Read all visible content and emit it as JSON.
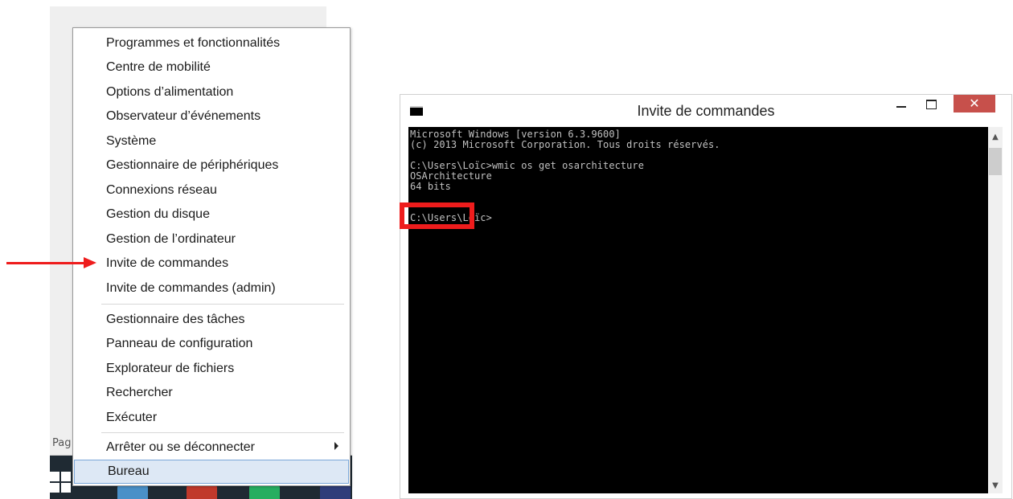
{
  "desktop": {
    "page_label": "Pag"
  },
  "context_menu": {
    "items": [
      {
        "label": "Programmes et fonctionnalités"
      },
      {
        "label": "Centre de mobilité"
      },
      {
        "label": "Options d’alimentation"
      },
      {
        "label": "Observateur d’événements"
      },
      {
        "label": "Système"
      },
      {
        "label": "Gestionnaire de périphériques"
      },
      {
        "label": "Connexions réseau"
      },
      {
        "label": "Gestion du disque"
      },
      {
        "label": "Gestion de l’ordinateur"
      },
      {
        "label": "Invite de commandes"
      },
      {
        "label": "Invite de commandes (admin)"
      },
      {
        "label": "Gestionnaire des tâches"
      },
      {
        "label": "Panneau de configuration"
      },
      {
        "label": "Explorateur de fichiers"
      },
      {
        "label": "Rechercher"
      },
      {
        "label": "Exécuter"
      },
      {
        "label": "Arrêter ou se déconnecter"
      },
      {
        "label": "Bureau"
      }
    ]
  },
  "cmd_window": {
    "title": "Invite de commandes",
    "close_symbol": "✕",
    "lines": [
      "Microsoft Windows [version 6.3.9600]",
      "(c) 2013 Microsoft Corporation. Tous droits réservés.",
      "",
      "C:\\Users\\Loïc>wmic os get osarchitecture",
      "OSArchitecture",
      "64 bits",
      "",
      "",
      "C:\\Users\\Loïc>"
    ]
  },
  "colors": {
    "annotation_red": "#ee1c1c",
    "console_bg": "#000000",
    "console_text": "#c0c0c0",
    "close_button": "#c7504b",
    "menu_highlight": "#dde8f5"
  }
}
